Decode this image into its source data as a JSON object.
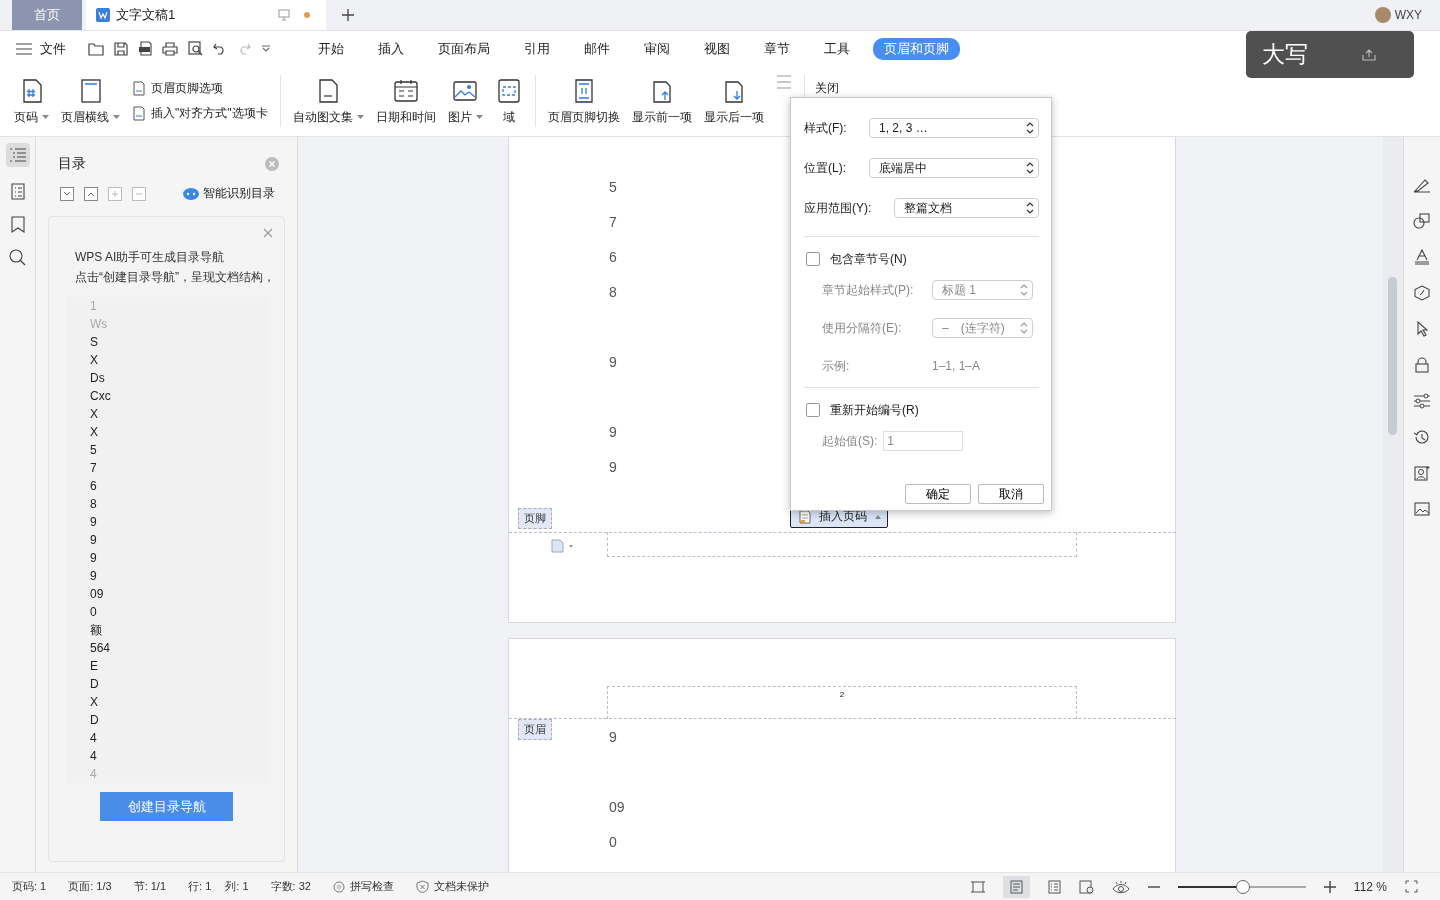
{
  "tabs": [
    {
      "label": "首页",
      "kind": "home",
      "selected": false
    },
    {
      "label": "文字文稿1",
      "kind": "doc",
      "selected": true
    }
  ],
  "user": {
    "name": "WXY"
  },
  "menu": {
    "file": "文件",
    "items": [
      {
        "label": "开始",
        "selected": false
      },
      {
        "label": "插入",
        "selected": false
      },
      {
        "label": "页面布局",
        "selected": false
      },
      {
        "label": "引用",
        "selected": false
      },
      {
        "label": "邮件",
        "selected": false
      },
      {
        "label": "审阅",
        "selected": false
      },
      {
        "label": "视图",
        "selected": false
      },
      {
        "label": "章节",
        "selected": false
      },
      {
        "label": "工具",
        "selected": false
      },
      {
        "label": "页眉和页脚",
        "selected": true
      }
    ]
  },
  "ribbon": [
    {
      "kind": "big",
      "label": "页码",
      "dropdown": true
    },
    {
      "kind": "big",
      "label": "页眉横线",
      "dropdown": true
    },
    {
      "kind": "stack",
      "items": [
        "页眉页脚选项",
        "插入\"对齐方式\"选项卡"
      ]
    },
    {
      "kind": "divider"
    },
    {
      "kind": "big",
      "label": "自动图文集",
      "dropdown": true
    },
    {
      "kind": "big",
      "label": "日期和时间",
      "dropdown": false
    },
    {
      "kind": "big",
      "label": "图片",
      "dropdown": true
    },
    {
      "kind": "big",
      "label": "域",
      "dropdown": false
    },
    {
      "kind": "divider"
    },
    {
      "kind": "big",
      "label": "页眉页脚切换",
      "dropdown": false
    },
    {
      "kind": "big",
      "label": "显示前一项",
      "dropdown": false
    },
    {
      "kind": "big",
      "label": "显示后一项",
      "dropdown": false
    },
    {
      "kind": "icon_only"
    },
    {
      "kind": "divider"
    },
    {
      "kind": "close",
      "label": "关闭"
    }
  ],
  "ime_overlay": {
    "text": "大写"
  },
  "nav": {
    "title": "目录",
    "smart_button": "智能识别目录",
    "ai_card": {
      "lines": [
        "WPS AI助手可生成目录导航",
        "点击“创建目录导航”，呈现文档结构，"
      ],
      "outline": [
        {
          "text": "1",
          "faded": true
        },
        {
          "text": "Ws",
          "faded": true
        },
        {
          "text": "S",
          "faded": false
        },
        {
          "text": "X",
          "faded": false
        },
        {
          "text": "Ds",
          "faded": false
        },
        {
          "text": "Cxc",
          "faded": false
        },
        {
          "text": "X",
          "faded": false
        },
        {
          "text": "X",
          "faded": false
        },
        {
          "text": "5",
          "faded": false
        },
        {
          "text": "7",
          "faded": false
        },
        {
          "text": "6",
          "faded": false
        },
        {
          "text": "8",
          "faded": false
        },
        {
          "text": "9",
          "faded": false
        },
        {
          "text": "9",
          "faded": false
        },
        {
          "text": "9",
          "faded": false
        },
        {
          "text": "9",
          "faded": false
        },
        {
          "text": "09",
          "faded": false
        },
        {
          "text": "0",
          "faded": false
        },
        {
          "text": "额",
          "faded": false
        },
        {
          "text": "564",
          "faded": false
        },
        {
          "text": "E",
          "faded": false
        },
        {
          "text": "D",
          "faded": false
        },
        {
          "text": "X",
          "faded": false
        },
        {
          "text": "D",
          "faded": false
        },
        {
          "text": "4",
          "faded": false
        },
        {
          "text": "4",
          "faded": false
        },
        {
          "text": "4",
          "faded": true
        }
      ],
      "button": "创建目录导航"
    }
  },
  "document": {
    "page1": {
      "lines": [
        {
          "text": "5",
          "blank_before": false
        },
        {
          "text": "7",
          "blank_before": false
        },
        {
          "text": "6",
          "blank_before": false
        },
        {
          "text": "8",
          "blank_before": false
        },
        {
          "text": "9",
          "blank_before": true
        },
        {
          "text": "9",
          "blank_before": true
        },
        {
          "text": "9",
          "blank_before": false
        }
      ],
      "footer_label": "页脚",
      "insert_button": "插入页码"
    },
    "page2": {
      "header_number": "2",
      "header_label": "页眉",
      "lines": [
        {
          "text": "9",
          "blank_before": false
        },
        {
          "text": "09",
          "blank_before": true
        },
        {
          "text": "0",
          "blank_before": false
        }
      ]
    }
  },
  "dialog": {
    "fields": [
      {
        "label": "样式(F):",
        "value": "1, 2, 3 …"
      },
      {
        "label": "位置(L):",
        "value": "底端居中"
      },
      {
        "label": "应用范围(Y):",
        "value": "整篇文档"
      }
    ],
    "chapter": {
      "label": "包含章节号(N)",
      "checked": false,
      "style_label": "章节起始样式(P):",
      "style_value": "标题 1",
      "sep_label": "使用分隔符(E):",
      "sep_value": "–　(连字符)",
      "example_label": "示例:",
      "example_value": "1–1, 1–A"
    },
    "restart": {
      "label": "重新开始编号(R)",
      "checked": false,
      "start_label": "起始值(S):",
      "start_value": "1"
    },
    "buttons": [
      "确定",
      "取消"
    ]
  },
  "status": {
    "items": [
      "页码: 1",
      "页面: 1/3",
      "节: 1/1",
      "行: 1",
      "列: 1",
      "字数: 32"
    ],
    "spell": "拼写检查",
    "protect": "文档未保护",
    "zoom": {
      "level": 0.51,
      "text": "112 %"
    }
  }
}
